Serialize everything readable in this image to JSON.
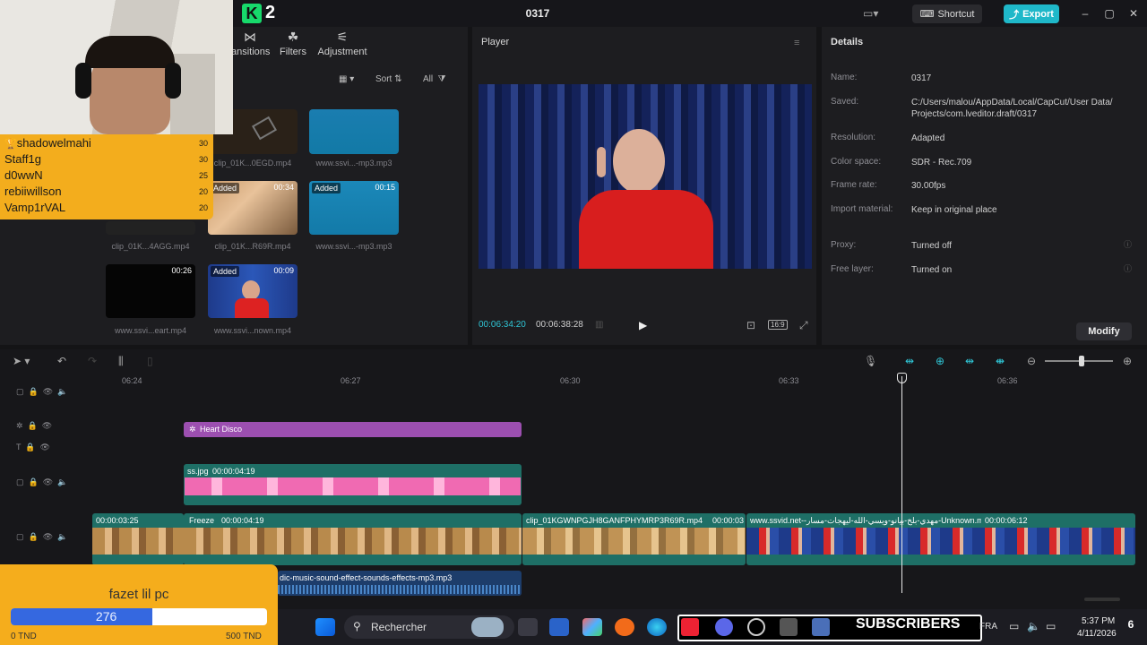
{
  "app": {
    "logo_number": "2",
    "project_title": "0317"
  },
  "titlebar": {
    "shortcut_label": "Shortcut",
    "export_label": "Export",
    "minimize": "–",
    "maximize": "▢",
    "close": "✕"
  },
  "media_toolbar": {
    "tabs": [
      {
        "label": "ansitions",
        "icon": "transitions-icon"
      },
      {
        "label": "Filters",
        "icon": "filters-icon"
      },
      {
        "label": "Adjustment",
        "icon": "adjustment-icon"
      }
    ],
    "sort_label": "Sort",
    "all_label": "All"
  },
  "media": [
    {
      "label": "clip_01K...0EGD.mp4",
      "duration": "",
      "added": false
    },
    {
      "label": "www.ssvi...-mp3.mp3",
      "duration": "",
      "added": false
    },
    {
      "label": "clip_01K...4AGG.mp4",
      "duration": "",
      "added": false
    },
    {
      "label": "clip_01K...R69R.mp4",
      "duration": "00:34",
      "added": true
    },
    {
      "label": "www.ssvi...-mp3.mp3",
      "duration": "00:15",
      "added": true
    },
    {
      "label": "www.ssvi...eart.mp4",
      "duration": "00:26",
      "added": false
    },
    {
      "label": "www.ssvi...nown.mp4",
      "duration": "00:09",
      "added": true
    }
  ],
  "added_label": "Added",
  "player": {
    "title": "Player",
    "current_time": "00:06:34:20",
    "total_time": "00:06:38:28",
    "ratio": "16:9"
  },
  "details": {
    "title": "Details",
    "rows": [
      {
        "label": "Name:",
        "value": "0317"
      },
      {
        "label": "Saved:",
        "value": "C:/Users/malou/AppData/Local/CapCut/User Data/ Projects/com.lveditor.draft/0317"
      },
      {
        "label": "Resolution:",
        "value": "Adapted"
      },
      {
        "label": "Color space:",
        "value": "SDR - Rec.709"
      },
      {
        "label": "Frame rate:",
        "value": "30.00fps"
      },
      {
        "label": "Import material:",
        "value": "Keep in original place"
      },
      {
        "label": "Proxy:",
        "value": "Turned off"
      },
      {
        "label": "Free layer:",
        "value": "Turned on"
      }
    ],
    "modify_label": "Modify"
  },
  "timeline": {
    "ruler": [
      "06:24",
      "06:27",
      "06:30",
      "06:33",
      "06:36"
    ],
    "effect_clip": "Heart Disco",
    "image_clip": {
      "name": "ss.jpg",
      "duration": "00:00:04:19"
    },
    "main_clips": [
      {
        "name": "",
        "duration": "00:00:03:25"
      },
      {
        "name": "Freeze",
        "duration": "00:00:04:19"
      },
      {
        "name": "clip_01KGWNPGJH8GANFPHYMRP3R69R.mp4",
        "duration": "00:00:03"
      },
      {
        "name": "www.ssvid.net--مهدي-بلخ-بيانو-ويسي-الله-ليهجات-مسار-Unknown.mp4",
        "duration": "00:00:06:12"
      }
    ],
    "audio_clip": "dic-music-sound-effect-sounds-effects-mp3.mp3"
  },
  "overlay": {
    "leaderboard": [
      {
        "name": "shadowelmahi",
        "score": "30"
      },
      {
        "name": "Staff1g",
        "score": "30"
      },
      {
        "name": "d0wwN",
        "score": "25"
      },
      {
        "name": "rebiiwillson",
        "score": "20"
      },
      {
        "name": "Vamp1rVAL",
        "score": "20"
      }
    ],
    "goal": {
      "title": "fazet lil pc",
      "current": "276",
      "progress": 0.552,
      "min_label": "0 TND",
      "max_label": "500 TND"
    }
  },
  "taskbar": {
    "search_label": "Rechercher",
    "subscribers_label": "SUBSCRIBERS",
    "language": "FRA",
    "time": "5:37 PM",
    "date": "4/11/2026",
    "notif": "6"
  }
}
